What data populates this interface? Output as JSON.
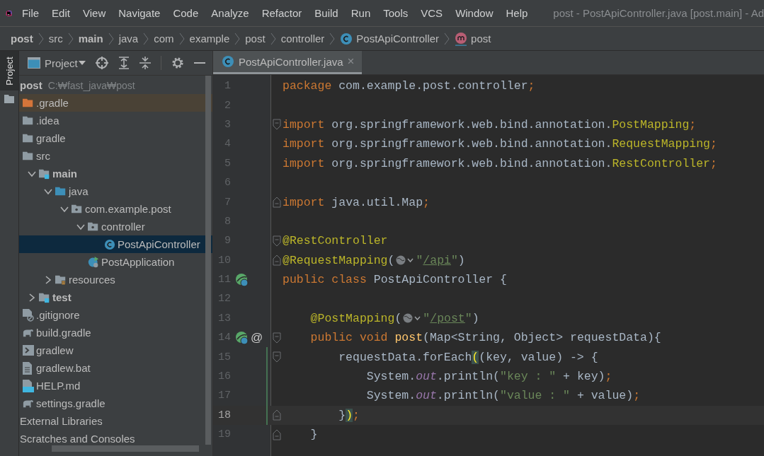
{
  "menu": [
    "File",
    "Edit",
    "View",
    "Navigate",
    "Code",
    "Analyze",
    "Refactor",
    "Build",
    "Run",
    "Tools",
    "VCS",
    "Window",
    "Help"
  ],
  "window": {
    "title": "post - PostApiController.java [post.main] - Ad"
  },
  "breadcrumb": [
    {
      "kind": "module",
      "label": "post"
    },
    {
      "kind": "folder",
      "label": "src"
    },
    {
      "kind": "source-root",
      "label": "main"
    },
    {
      "kind": "folder",
      "label": "java"
    },
    {
      "kind": "folder",
      "label": "com"
    },
    {
      "kind": "folder",
      "label": "example"
    },
    {
      "kind": "folder",
      "label": "post"
    },
    {
      "kind": "folder",
      "label": "controller"
    },
    {
      "kind": "class",
      "label": "PostApiController"
    },
    {
      "kind": "method",
      "label": "post"
    }
  ],
  "tool_strip": {
    "label": "Project"
  },
  "project_panel": {
    "view": "Project",
    "tree": [
      {
        "kind": "module",
        "name": "post",
        "path": "C:₩fast_java₩post",
        "selected": false,
        "children": [
          {
            "kind": "excluded-folder",
            "name": ".gradle",
            "selected": false
          },
          {
            "kind": "folder",
            "name": ".idea",
            "selected": false
          },
          {
            "kind": "folder",
            "name": "gradle",
            "selected": false
          },
          {
            "kind": "folder",
            "name": "src",
            "selected": false,
            "children": [
              {
                "kind": "source-root",
                "name": "main",
                "selected": false,
                "expanded": true,
                "children": [
                  {
                    "kind": "java-root",
                    "name": "java",
                    "selected": false,
                    "expanded": true,
                    "children": [
                      {
                        "kind": "package",
                        "name": "com.example.post",
                        "selected": false,
                        "expanded": true,
                        "children": [
                          {
                            "kind": "package",
                            "name": "controller",
                            "selected": false,
                            "expanded": true,
                            "children": [
                              {
                                "kind": "class",
                                "name": "PostApiController",
                                "selected": true
                              }
                            ]
                          },
                          {
                            "kind": "spring-app",
                            "name": "PostApplication",
                            "selected": false
                          }
                        ]
                      }
                    ]
                  },
                  {
                    "kind": "resources",
                    "name": "resources",
                    "selected": false,
                    "expanded": false
                  }
                ]
              },
              {
                "kind": "source-root",
                "name": "test",
                "selected": false,
                "expanded": false
              }
            ]
          },
          {
            "kind": "gitignore",
            "name": ".gitignore",
            "selected": false
          },
          {
            "kind": "gradle",
            "name": "build.gradle",
            "selected": false
          },
          {
            "kind": "terminal",
            "name": "gradlew",
            "selected": false
          },
          {
            "kind": "text-file",
            "name": "gradlew.bat",
            "selected": false
          },
          {
            "kind": "markdown",
            "name": "HELP.md",
            "selected": false
          },
          {
            "kind": "gradle",
            "name": "settings.gradle",
            "selected": false
          }
        ]
      },
      {
        "kind": "plain",
        "name": "External Libraries",
        "selected": false
      },
      {
        "kind": "plain",
        "name": "Scratches and Consoles",
        "selected": false
      }
    ]
  },
  "tabs": [
    {
      "label": "PostApiController.java",
      "close": "×",
      "selected": true
    }
  ],
  "editor": {
    "lines": [
      {
        "number": "1",
        "current": false,
        "changed": false,
        "tokens": [
          {
            "kind": "keyword",
            "text": "package"
          },
          {
            "kind": "plain",
            "text": " com.example.post.controller"
          },
          {
            "kind": "keyword",
            "text": ";"
          }
        ]
      },
      {
        "number": "2",
        "current": false,
        "changed": false
      },
      {
        "number": "3",
        "current": false,
        "changed": false,
        "fold": {
          "kind": "start"
        },
        "tokens": [
          {
            "kind": "keyword",
            "text": "import"
          },
          {
            "kind": "plain",
            "text": " org.springframework.web.bind.annotation."
          },
          {
            "kind": "annotation",
            "text": "PostMapping"
          },
          {
            "kind": "keyword",
            "text": ";"
          }
        ]
      },
      {
        "number": "4",
        "current": false,
        "changed": false,
        "tokens": [
          {
            "kind": "keyword",
            "text": "import"
          },
          {
            "kind": "plain",
            "text": " org.springframework.web.bind.annotation."
          },
          {
            "kind": "annotation",
            "text": "RequestMapping"
          },
          {
            "kind": "keyword",
            "text": ";"
          }
        ]
      },
      {
        "number": "5",
        "current": false,
        "changed": false,
        "tokens": [
          {
            "kind": "keyword",
            "text": "import"
          },
          {
            "kind": "plain",
            "text": " org.springframework.web.bind.annotation."
          },
          {
            "kind": "annotation",
            "text": "RestController"
          },
          {
            "kind": "keyword",
            "text": ";"
          }
        ]
      },
      {
        "number": "6",
        "current": false,
        "changed": false
      },
      {
        "number": "7",
        "current": false,
        "changed": false,
        "fold": {
          "kind": "end"
        },
        "tokens": [
          {
            "kind": "keyword",
            "text": "import"
          },
          {
            "kind": "plain",
            "text": " java.util.Map"
          },
          {
            "kind": "keyword",
            "text": ";"
          }
        ]
      },
      {
        "number": "8",
        "current": false,
        "changed": false
      },
      {
        "number": "9",
        "current": false,
        "changed": false,
        "fold": {
          "kind": "start"
        },
        "tokens": [
          {
            "kind": "annotation",
            "text": "@RestController"
          }
        ]
      },
      {
        "number": "10",
        "current": false,
        "changed": false,
        "fold": {
          "kind": "end"
        },
        "tokens": [
          {
            "kind": "annotation",
            "text": "@RequestMapping"
          },
          {
            "kind": "plain",
            "text": "("
          },
          {
            "kind": "globe"
          },
          {
            "kind": "string",
            "text": "\""
          },
          {
            "kind": "url",
            "text": "/api"
          },
          {
            "kind": "string",
            "text": "\""
          },
          {
            "kind": "plain",
            "text": ")"
          }
        ]
      },
      {
        "number": "11",
        "current": false,
        "changed": false,
        "gutter": {
          "kind": "bean"
        },
        "tokens": [
          {
            "kind": "keyword",
            "text": "public class "
          },
          {
            "kind": "plain",
            "text": "PostApiController {"
          }
        ]
      },
      {
        "number": "12",
        "current": false,
        "changed": false
      },
      {
        "number": "13",
        "current": false,
        "changed": false,
        "tokens": [
          {
            "kind": "annotation",
            "text": "    @PostMapping"
          },
          {
            "kind": "plain",
            "text": "("
          },
          {
            "kind": "globe"
          },
          {
            "kind": "string",
            "text": "\""
          },
          {
            "kind": "url",
            "text": "/post"
          },
          {
            "kind": "string",
            "text": "\""
          },
          {
            "kind": "plain",
            "text": ")"
          }
        ]
      },
      {
        "number": "14",
        "current": false,
        "changed": false,
        "fold": {
          "kind": "start"
        },
        "gutter": {
          "kind": "bean",
          "mark": "@"
        },
        "tokens": [
          {
            "kind": "keyword",
            "text": "    public void "
          },
          {
            "kind": "method",
            "text": "post"
          },
          {
            "kind": "plain",
            "text": "(Map<String, Object> requestData){"
          }
        ]
      },
      {
        "number": "15",
        "current": false,
        "changed": true,
        "fold": {
          "kind": "start"
        },
        "tokens": [
          {
            "kind": "plain",
            "text": "        requestData.forEach"
          },
          {
            "kind": "brace-match",
            "text": "("
          },
          {
            "kind": "plain",
            "text": "(key, value) -> {"
          }
        ]
      },
      {
        "number": "16",
        "current": false,
        "changed": true,
        "tokens": [
          {
            "kind": "plain",
            "text": "            System."
          },
          {
            "kind": "static",
            "text": "out"
          },
          {
            "kind": "plain",
            "text": ".println("
          },
          {
            "kind": "string",
            "text": "\"key : \""
          },
          {
            "kind": "plain",
            "text": " + key)"
          },
          {
            "kind": "keyword",
            "text": ";"
          }
        ]
      },
      {
        "number": "17",
        "current": false,
        "changed": true,
        "tokens": [
          {
            "kind": "plain",
            "text": "            System."
          },
          {
            "kind": "static",
            "text": "out"
          },
          {
            "kind": "plain",
            "text": ".println("
          },
          {
            "kind": "string",
            "text": "\"value : \""
          },
          {
            "kind": "plain",
            "text": " + value)"
          },
          {
            "kind": "keyword",
            "text": ";"
          }
        ]
      },
      {
        "number": "18",
        "current": true,
        "changed": true,
        "fold": {
          "kind": "end"
        },
        "tokens": [
          {
            "kind": "plain",
            "text": "        }"
          },
          {
            "kind": "brace-match",
            "text": ")"
          },
          {
            "kind": "keyword",
            "text": ";"
          }
        ]
      },
      {
        "number": "19",
        "current": false,
        "changed": false,
        "fold": {
          "kind": "end"
        },
        "tokens": [
          {
            "kind": "plain",
            "text": "    }"
          }
        ]
      }
    ]
  }
}
